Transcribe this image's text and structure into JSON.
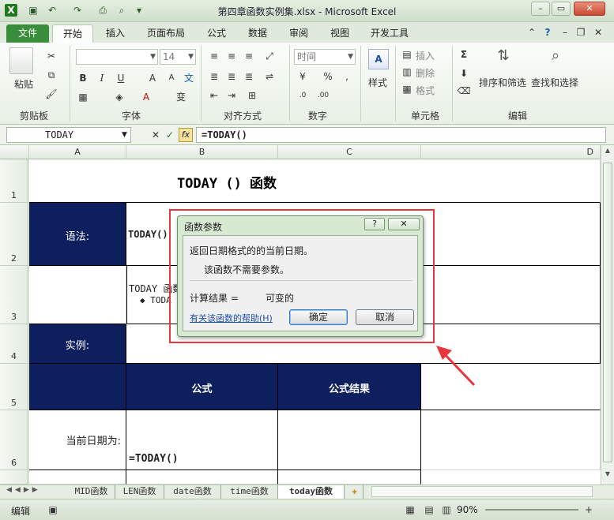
{
  "window": {
    "title": "第四章函数实例集.xlsx - Microsoft Excel"
  },
  "tabs": [
    {
      "label": "文件"
    },
    {
      "label": "开始"
    },
    {
      "label": "插入"
    },
    {
      "label": "页面布局"
    },
    {
      "label": "公式"
    },
    {
      "label": "数据"
    },
    {
      "label": "审阅"
    },
    {
      "label": "视图"
    },
    {
      "label": "开发工具"
    }
  ],
  "ribbon": {
    "clipboard": {
      "label": "剪贴板",
      "paste": "粘贴"
    },
    "font": {
      "label": "字体",
      "font_size": "14"
    },
    "alignment": {
      "label": "对齐方式"
    },
    "number": {
      "label": "数字",
      "format": "时间"
    },
    "styles": {
      "label": "样式",
      "button": "样式"
    },
    "cells": {
      "label": "单元格",
      "insert": "插入",
      "delete": "删除",
      "format": "格式"
    },
    "editing": {
      "label": "编辑",
      "sort": "排序和筛选",
      "find": "查找和选择"
    }
  },
  "formula_bar": {
    "name_box": "TODAY",
    "formula": "=TODAY()",
    "fx": "fx"
  },
  "columns": [
    "A",
    "B",
    "C",
    "D"
  ],
  "rows": [
    "1",
    "2",
    "3",
    "4",
    "5",
    "6"
  ],
  "cells": {
    "title": "TODAY () 函数",
    "syntax_label": "语法:",
    "syntax_value": "TODAY()",
    "desc_line1": "TODAY 函数",
    "desc_line2": "◆ TODA",
    "example_label": "实例:",
    "formula_header": "公式",
    "result_header": "公式结果",
    "current_date_label": "当前日期为:",
    "formula_value": "=TODAY()"
  },
  "sheet_tabs": [
    "MID函数",
    "LEN函数",
    "date函数",
    "time函数",
    "today函数"
  ],
  "active_sheet": "today函数",
  "status": {
    "mode": "编辑",
    "zoom": "90%"
  },
  "dialog": {
    "title": "函数参数",
    "help_glyph": "?",
    "close_glyph": "✕",
    "description": "返回日期格式的的当前日期。",
    "no_args": "该函数不需要参数。",
    "result_label": "计算结果 =",
    "result_value": "可变的",
    "help_link": "有关该函数的帮助(H)",
    "ok": "确定",
    "cancel": "取消"
  }
}
